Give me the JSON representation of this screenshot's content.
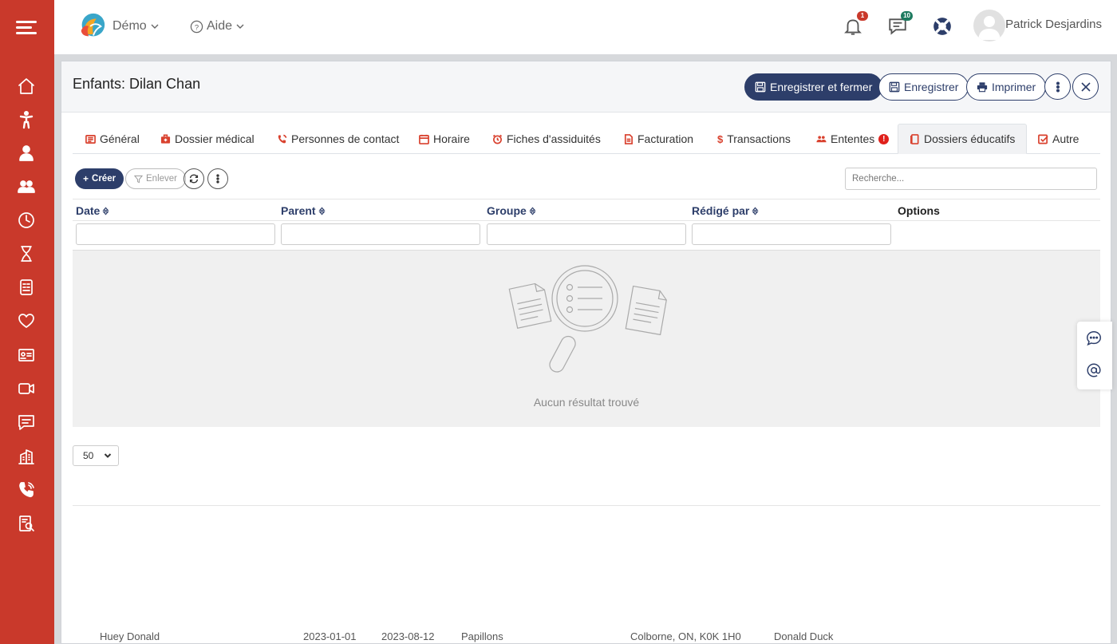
{
  "app": {
    "brand_menu": "Démo",
    "help_menu": "Aide",
    "notifications_count": "1",
    "messages_count": "10",
    "user_name": "Patrick Desjardins"
  },
  "sidebar": {
    "items": [
      "home-icon",
      "child-icon",
      "person-icon",
      "group-icon",
      "clock-icon",
      "hourglass-icon",
      "report-icon",
      "heart-icon",
      "id-card-icon",
      "video-icon",
      "chat-icon",
      "building-icon",
      "phone-icon",
      "audit-icon"
    ]
  },
  "panel": {
    "title": "Enfants: Dilan Chan",
    "save_close_label": "Enregistrer et fermer",
    "save_label": "Enregistrer",
    "print_label": "Imprimer"
  },
  "tabs": [
    {
      "label": "Général",
      "icon": "list-icon"
    },
    {
      "label": "Dossier médical",
      "icon": "medkit-icon"
    },
    {
      "label": "Personnes de contact",
      "icon": "phone-icon"
    },
    {
      "label": "Horaire",
      "icon": "calendar-icon"
    },
    {
      "label": "Fiches d'assiduités",
      "icon": "alarm-icon"
    },
    {
      "label": "Facturation",
      "icon": "invoice-icon"
    },
    {
      "label": "Transactions",
      "icon": "dollar-icon"
    },
    {
      "label": "Ententes",
      "icon": "people-icon"
    },
    {
      "label": "Dossiers éducatifs",
      "icon": "file-icon",
      "active": true
    },
    {
      "label": "Autre",
      "icon": "check-icon"
    }
  ],
  "toolbar": {
    "create_label": "Créer",
    "remove_label": "Enlever",
    "search_placeholder": "Recherche..."
  },
  "table": {
    "columns": [
      "Date",
      "Parent",
      "Groupe",
      "Rédigé par",
      "Options"
    ],
    "empty_text": "Aucun résultat trouvé",
    "page_size": "50"
  },
  "background_row": {
    "name": "Huey Donald",
    "date1": "2023-01-01",
    "date2": "2023-08-12",
    "group": "Papillons",
    "address": "Colborne, ON, K0K 1H0",
    "parent": "Donald Duck"
  },
  "colors": {
    "sidebar": "#c9392b",
    "primary": "#2d3e6a",
    "tab_icon": "#d9412e"
  }
}
